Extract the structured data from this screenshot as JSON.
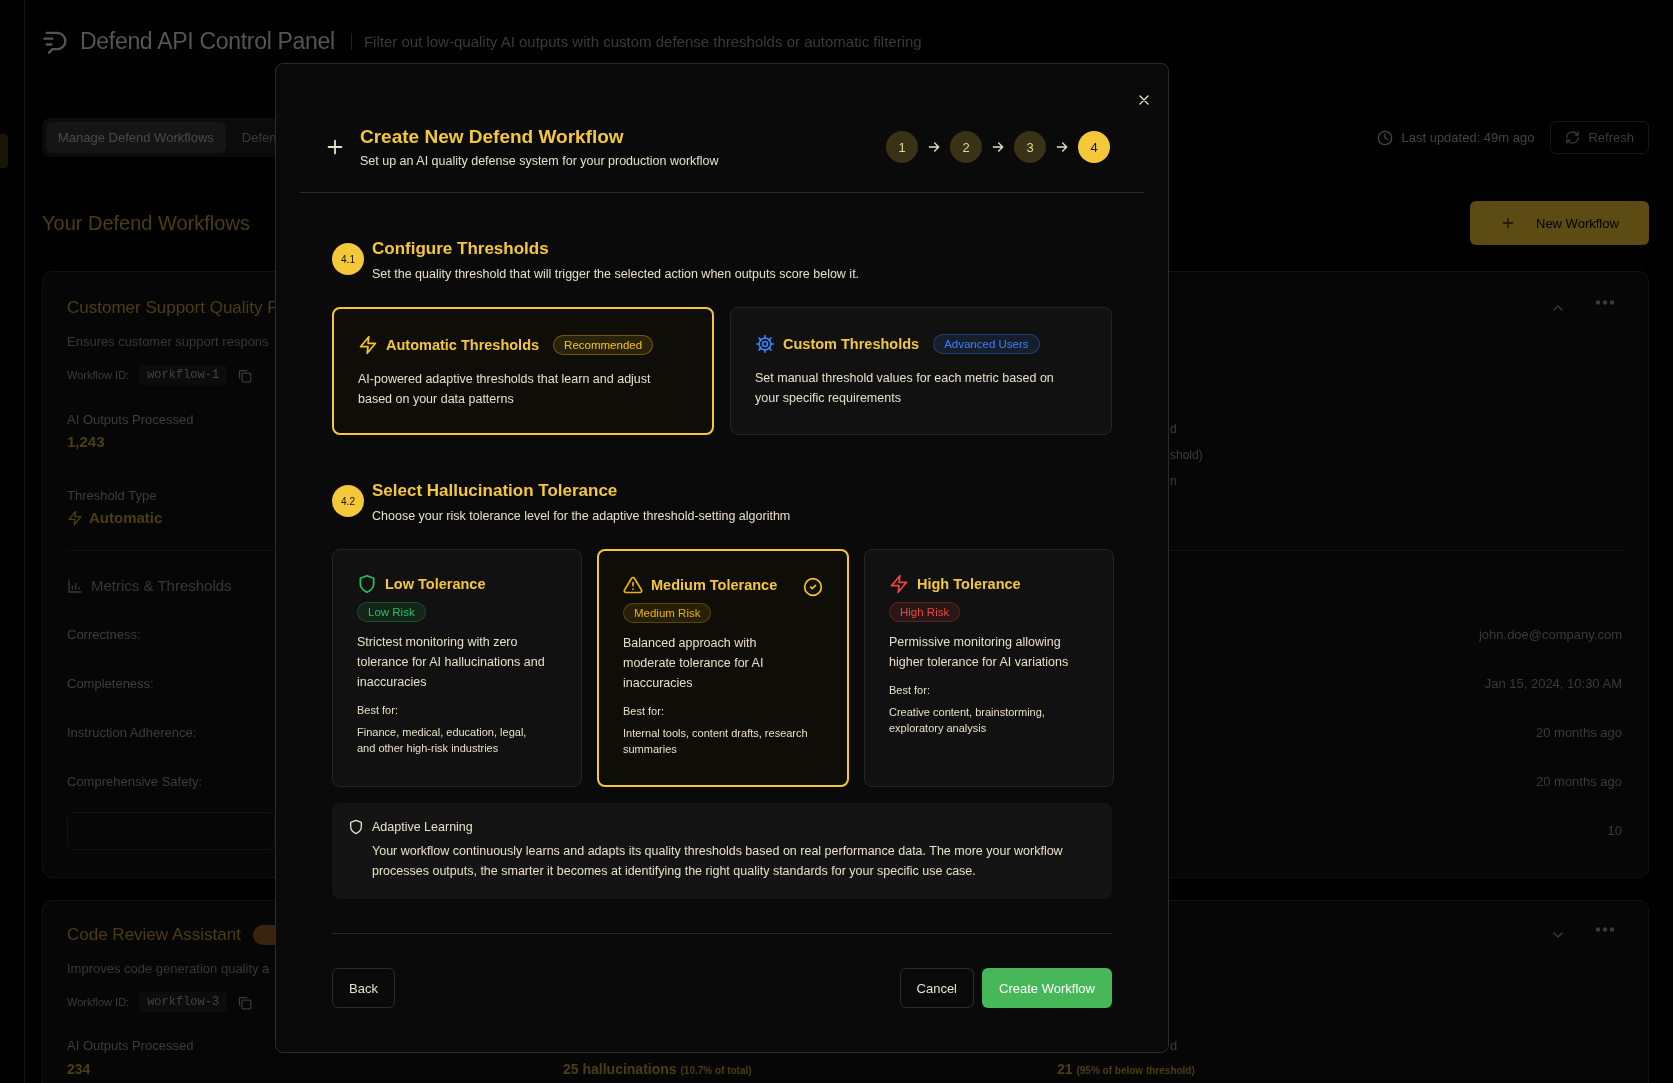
{
  "header": {
    "title": "Defend API Control Panel",
    "subtitle": "Filter out low-quality AI outputs with custom defense thresholds or automatic filtering"
  },
  "tabs": [
    {
      "label": "Manage Defend Workflows",
      "selected": true
    },
    {
      "label": "Defen",
      "selected": false
    }
  ],
  "last_updated": "Last updated: 49m ago",
  "refresh_button": "Refresh",
  "section_title": "Your Defend Workflows",
  "new_workflow_button": "New Workflow",
  "workflows": [
    {
      "name": "Customer Support Quality F",
      "description": "Ensures customer support respons",
      "workflow_id_label": "Workflow ID:",
      "workflow_id": "workflow-1",
      "expanded": true,
      "processed_label": "AI Outputs Processed",
      "processed": "1,243",
      "right_fragments": [
        "d",
        "shold)",
        "n"
      ],
      "threshold_type_label": "Threshold Type",
      "threshold_type": "Automatic",
      "metrics_title": "Metrics & Thresholds",
      "metrics": [
        "Correctness:",
        "Completeness:",
        "Instruction Adherence:",
        "Comprehensive Safety:"
      ],
      "details": [
        "john.doe@company.com",
        "Jan 15, 2024, 10:30 AM",
        "20 months ago",
        "20 months ago",
        "10"
      ]
    },
    {
      "name": "Code Review Assistant",
      "description": "Improves code generation quality a",
      "workflow_id_label": "Workflow ID:",
      "workflow_id": "workflow-3",
      "expanded": false,
      "processed_label": "AI Outputs Processed",
      "processed": "234",
      "right_fragments": [
        "d"
      ],
      "below_threshold": "25 hallucinations",
      "below_threshold_note": "(10.7% of total)",
      "improved": "21",
      "improved_note": "(95% of below threshold)"
    }
  ],
  "modal": {
    "title": "Create New Defend Workflow",
    "subtitle": "Set up an AI quality defense system for your production workflow",
    "steps": [
      {
        "label": "1",
        "selected": false
      },
      {
        "label": "2",
        "selected": false
      },
      {
        "label": "3",
        "selected": false
      },
      {
        "label": "4",
        "selected": true
      }
    ],
    "threshold_section": {
      "number": "4.1",
      "title": "Configure Thresholds",
      "description": "Set the quality threshold that will trigger the selected action when outputs score below it.",
      "options": [
        {
          "kind": "automatic",
          "title": "Automatic Thresholds",
          "badge": "Recommended",
          "color": "#f5c518",
          "description": "AI-powered adaptive thresholds that learn and adjust based on your data patterns",
          "selected": true
        },
        {
          "kind": "custom",
          "title": "Custom Thresholds",
          "badge": "Advanced Users",
          "color": "#3b82f6",
          "description": "Set manual threshold values for each metric based on your specific requirements",
          "selected": false
        }
      ]
    },
    "tolerance_section": {
      "number": "4.2",
      "title": "Select Hallucination Tolerance",
      "description": "Choose your risk tolerance level for the adaptive threshold-setting algorithm",
      "options": [
        {
          "kind": "low",
          "title": "Low Tolerance",
          "badge": "Low Risk",
          "color": "#22c55e",
          "description": "Strictest monitoring with zero tolerance for AI hallucinations and inaccuracies",
          "best_for_label": "Best for:",
          "best_for": "Finance, medical, education, legal, and other high-risk industries",
          "selected": false
        },
        {
          "kind": "medium",
          "title": "Medium Tolerance",
          "badge": "Medium Risk",
          "color": "#eab308",
          "description": "Balanced approach with moderate tolerance for AI inaccuracies",
          "best_for_label": "Best for:",
          "best_for": "Internal tools, content drafts, research summaries",
          "selected": true
        },
        {
          "kind": "high",
          "title": "High Tolerance",
          "badge": "High Risk",
          "color": "#ef4444",
          "description": "Permissive monitoring allowing higher tolerance for AI variations",
          "best_for_label": "Best for:",
          "best_for": "Creative content, brainstorming, exploratory analysis",
          "selected": false
        }
      ]
    },
    "note": {
      "title": "Adaptive Learning",
      "text": "Your workflow continuously learns and adapts its quality thresholds based on real performance data. The more your workflow processes outputs, the smarter it becomes at identifying the right quality standards for your specific use case."
    },
    "back_button": "Back",
    "cancel_button": "Cancel",
    "create_button": "Create Workflow"
  }
}
